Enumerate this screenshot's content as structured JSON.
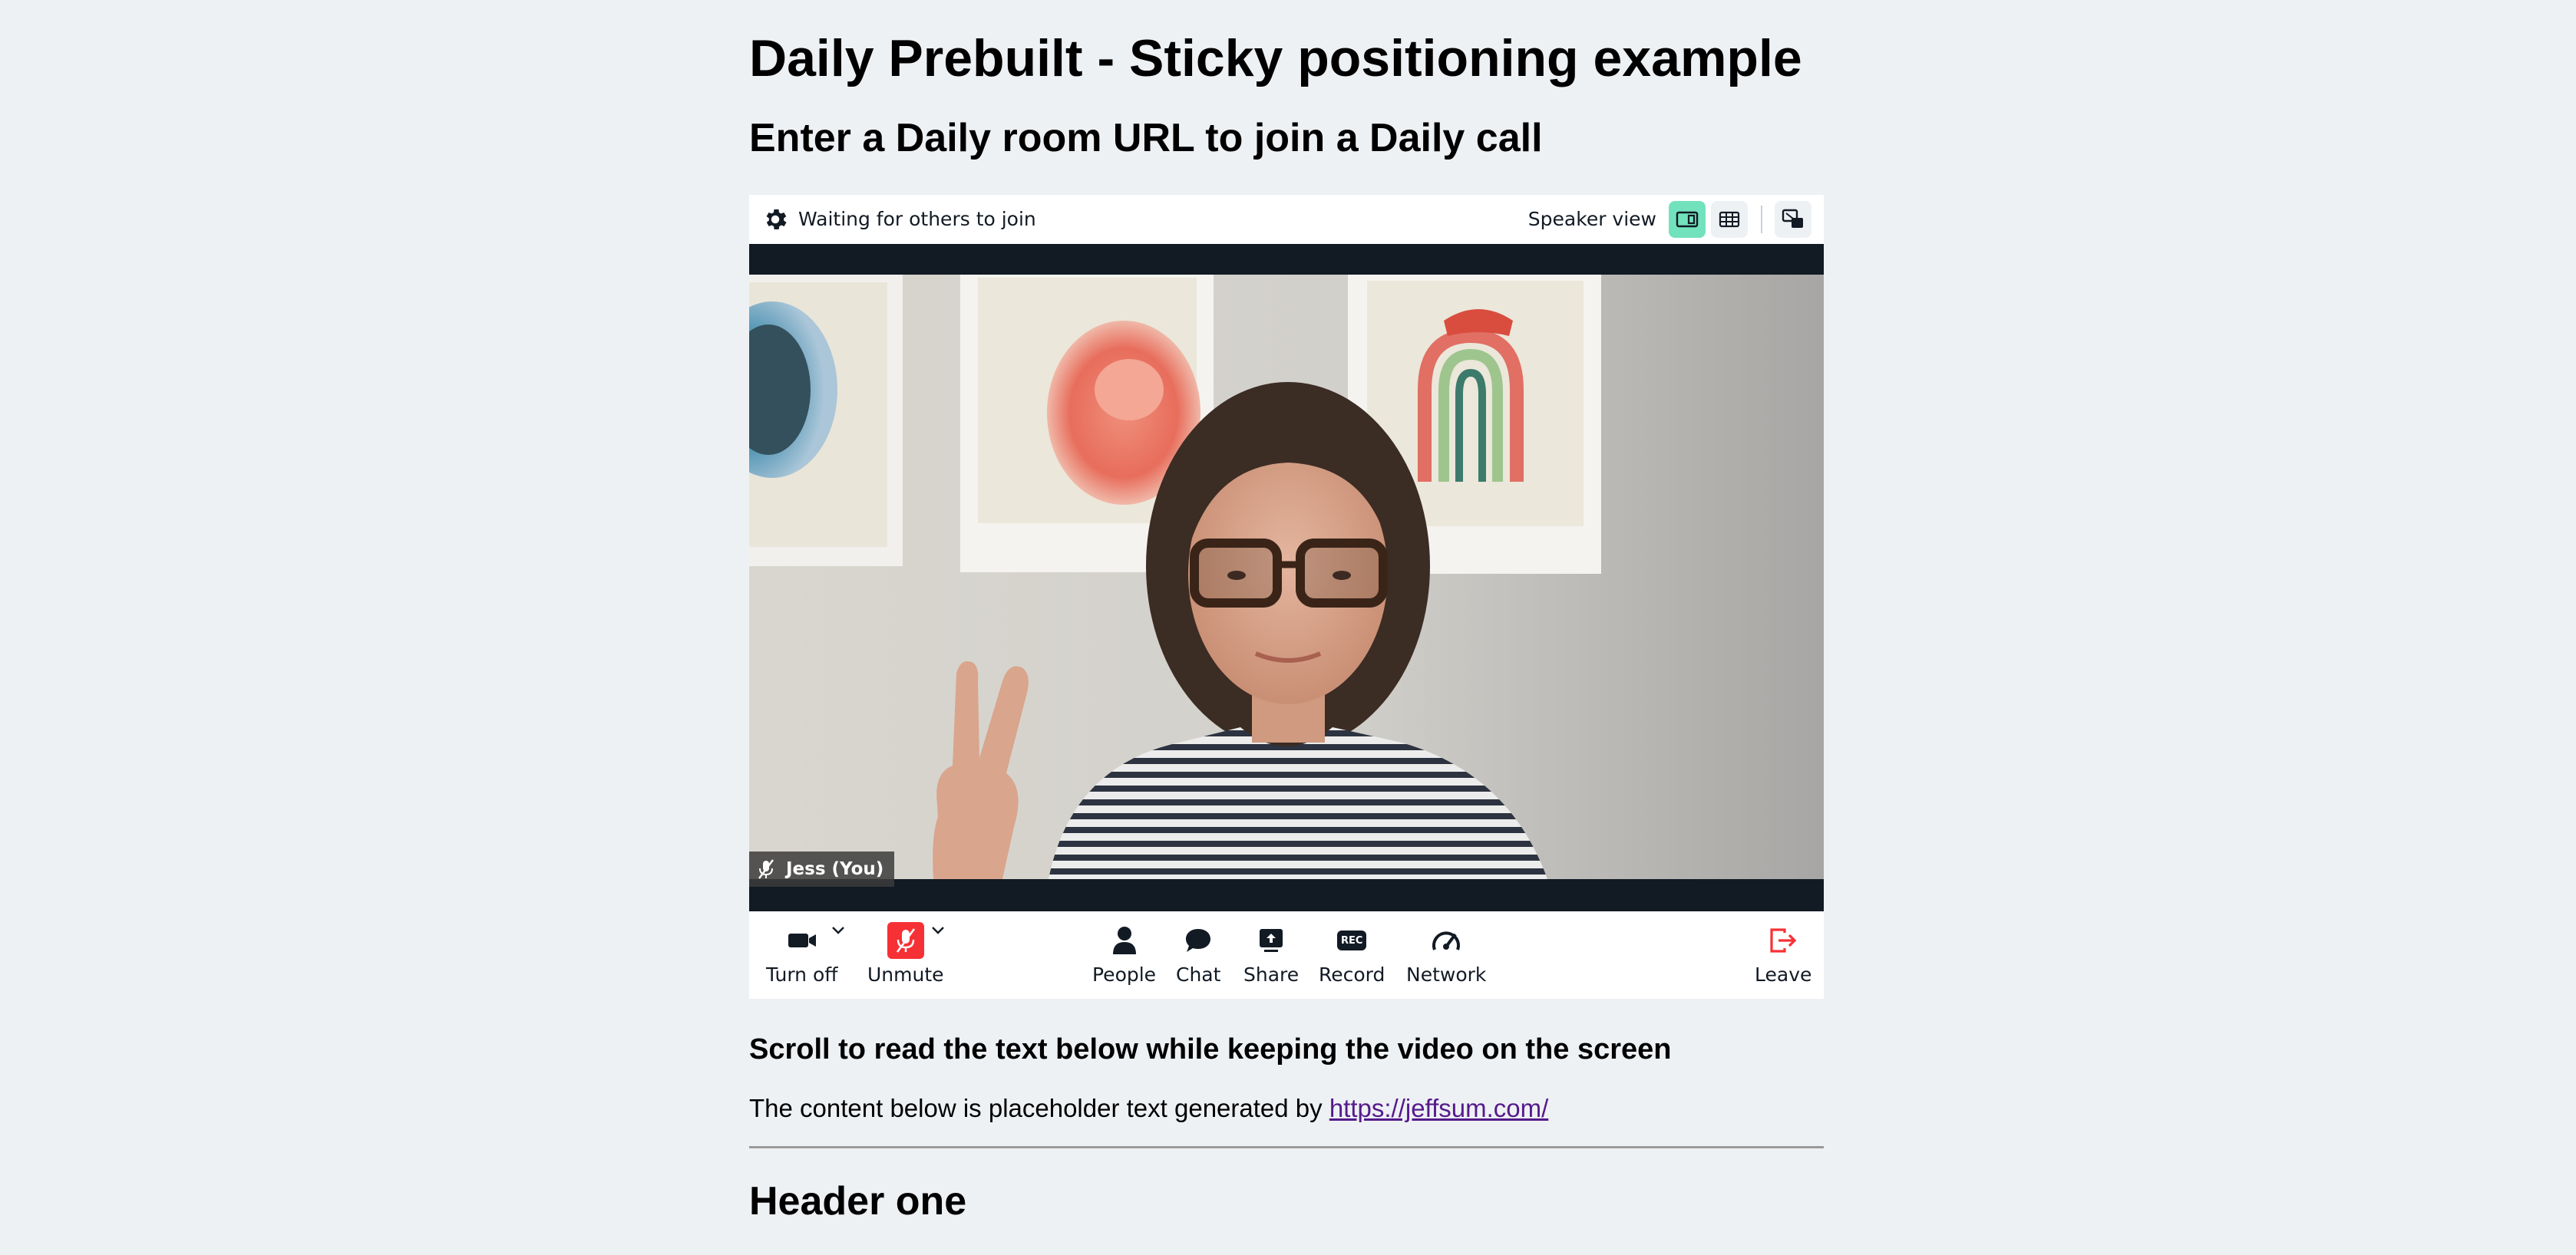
{
  "page": {
    "title": "Daily Prebuilt - Sticky positioning example",
    "subtitle": "Enter a Daily room URL to join a Daily call"
  },
  "call": {
    "topbar": {
      "status": "Waiting for others to join",
      "view_label": "Speaker view",
      "active_view": "speaker"
    },
    "participant": {
      "name": "Jess (You)",
      "muted": true
    },
    "tray": {
      "camera": "Turn off",
      "mic": "Unmute",
      "people": "People",
      "chat": "Chat",
      "share": "Share",
      "record": "Record",
      "record_badge": "REC",
      "network": "Network",
      "leave": "Leave"
    },
    "colors": {
      "accent": "#72e2bd",
      "danger": "#f63135",
      "dark": "#121a24"
    }
  },
  "article": {
    "scroll_heading": "Scroll to read the text below while keeping the video on the screen",
    "intro_text": "The content below is placeholder text generated by ",
    "intro_link": "https://jeffsum.com/",
    "section_heading": "Header one"
  }
}
